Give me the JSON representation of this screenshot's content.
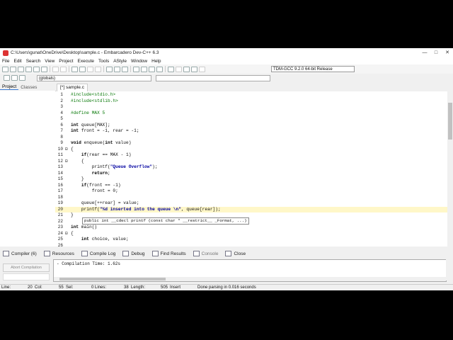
{
  "window": {
    "title": "C:\\Users\\gunat\\OneDrive\\Desktop\\sample.c - Embarcadero Dev-C++ 6.3",
    "minimize": "—",
    "maximize": "□",
    "close": "✕"
  },
  "menu": [
    "File",
    "Edit",
    "Search",
    "View",
    "Project",
    "Execute",
    "Tools",
    "AStyle",
    "Window",
    "Help"
  ],
  "toolbar": {
    "compiler": "TDM-GCC 9.2.0 64-bit Release"
  },
  "scope": {
    "globals": "(globals)"
  },
  "left_tabs": {
    "project": "Project",
    "classes": "Classes"
  },
  "file_tab": "[*] sample.c",
  "code_lines": [
    {
      "n": "1",
      "fold": "",
      "html": "<span class='pp'>#include&lt;stdio.h&gt;</span>"
    },
    {
      "n": "2",
      "fold": "",
      "html": "<span class='pp'>#include&lt;stdlib.h&gt;</span>"
    },
    {
      "n": "3",
      "fold": "",
      "html": ""
    },
    {
      "n": "4",
      "fold": "",
      "html": "<span class='pp'>#define MAX 5</span>"
    },
    {
      "n": "5",
      "fold": "",
      "html": ""
    },
    {
      "n": "6",
      "fold": "",
      "html": "<span class='kw'>int</span> queue[MAX];"
    },
    {
      "n": "7",
      "fold": "",
      "html": "<span class='kw'>int</span> front = -1, rear = -1;"
    },
    {
      "n": "8",
      "fold": "",
      "html": ""
    },
    {
      "n": "9",
      "fold": "",
      "html": "<span class='kw'>void</span> enqueue(<span class='kw'>int</span> value)"
    },
    {
      "n": "10",
      "fold": "⊟",
      "html": "{"
    },
    {
      "n": "11",
      "fold": "",
      "html": "    <span class='kw'>if</span>(rear == MAX - 1)"
    },
    {
      "n": "12",
      "fold": "⊟",
      "html": "    {"
    },
    {
      "n": "13",
      "fold": "",
      "html": "        printf(<span class='str'>\"Queue Overflow\"</span>);"
    },
    {
      "n": "14",
      "fold": "",
      "html": "        <span class='kw'>return</span>;"
    },
    {
      "n": "15",
      "fold": "",
      "html": "    }"
    },
    {
      "n": "16",
      "fold": "",
      "html": "    <span class='kw'>if</span>(front == -1)"
    },
    {
      "n": "17",
      "fold": "",
      "html": "        front = 0;"
    },
    {
      "n": "18",
      "fold": "",
      "html": ""
    },
    {
      "n": "19",
      "fold": "",
      "html": "    queue[++rear] = value;"
    },
    {
      "n": "20",
      "fold": "",
      "html": "    printf(<span class='str'>\"%d inserted into the queue \\n\"</span>, queue[rear]);",
      "highlight": true
    },
    {
      "n": "21",
      "fold": "",
      "html": "}"
    },
    {
      "n": "22",
      "fold": "",
      "html": ""
    },
    {
      "n": "23",
      "fold": "",
      "html": "<span class='kw'>int</span> main()"
    },
    {
      "n": "24",
      "fold": "⊟",
      "html": "{"
    },
    {
      "n": "25",
      "fold": "",
      "html": "    <span class='kw'>int</span> choice, value;"
    },
    {
      "n": "26",
      "fold": "",
      "html": ""
    }
  ],
  "tooltip": "public int __cdecl printf (const char * __restrict__ _Format, ...)",
  "bottom_tabs": [
    {
      "label": "Compiler (6)",
      "dim": false
    },
    {
      "label": "Resources",
      "dim": false
    },
    {
      "label": "Compile Log",
      "dim": false
    },
    {
      "label": "Debug",
      "dim": false
    },
    {
      "label": "Find Results",
      "dim": false
    },
    {
      "label": "Console",
      "dim": true
    },
    {
      "label": "Close",
      "dim": false
    }
  ],
  "abort_label": "Abort Compilation",
  "output_text": "- Compilation Time: 1.62s",
  "status": {
    "line_label": "Line:",
    "line_value": "20",
    "col_label": "Col:",
    "col_value": "55",
    "sel_label": "Sel:",
    "sel_value": "0",
    "lines_label": "Lines:",
    "lines_value": "38",
    "length_label": "Length:",
    "length_value": "505",
    "mode": "Insert",
    "message": "Done parsing in 0.016 seconds"
  }
}
